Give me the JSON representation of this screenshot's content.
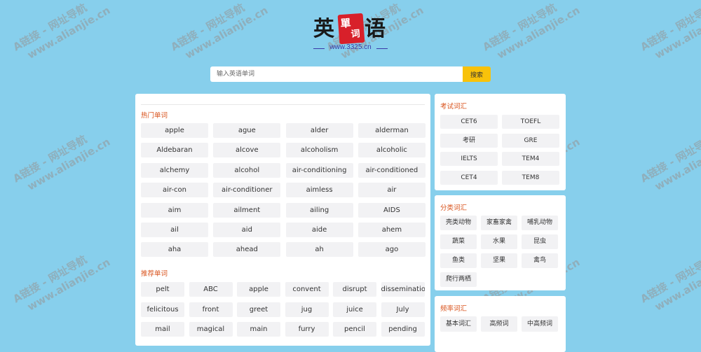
{
  "logo": {
    "char1": "英",
    "seal_char1": "單",
    "seal_char2": "词",
    "char2": "语",
    "url": "www.3325.cn"
  },
  "search": {
    "placeholder": "输入英语单词",
    "button_label": "搜索"
  },
  "hot": {
    "title": "热门单词",
    "items": [
      "apple",
      "ague",
      "alder",
      "alderman",
      "Aldebaran",
      "alcove",
      "alcoholism",
      "alcoholic",
      "alchemy",
      "alcohol",
      "air-conditioning",
      "air-conditioned",
      "air-con",
      "air-conditioner",
      "aimless",
      "air",
      "aim",
      "ailment",
      "ailing",
      "AIDS",
      "ail",
      "aid",
      "aide",
      "ahem",
      "aha",
      "ahead",
      "ah",
      "ago"
    ]
  },
  "recommended": {
    "title": "推荐单词",
    "items": [
      "pelt",
      "ABC",
      "apple",
      "convent",
      "disrupt",
      "dissemination",
      "felicitous",
      "front",
      "greet",
      "jug",
      "juice",
      "July",
      "mail",
      "magical",
      "main",
      "furry",
      "pencil",
      "pending"
    ]
  },
  "exam": {
    "title": "考试词汇",
    "items": [
      "CET6",
      "TOEFL",
      "考研",
      "GRE",
      "IELTS",
      "TEM4",
      "CET4",
      "TEM8"
    ]
  },
  "category": {
    "title": "分类词汇",
    "items": [
      "壳类动物",
      "家畜家禽",
      "哺乳动物",
      "蔬菜",
      "水果",
      "昆虫",
      "鱼类",
      "坚果",
      "禽鸟",
      "爬行两栖"
    ]
  },
  "frequency": {
    "title": "频率词汇",
    "items": [
      "基本词汇",
      "高频词",
      "中高频词"
    ]
  },
  "watermark": {
    "line1": "A链接 - 网址导航",
    "line2": "www.alianjie.cn"
  }
}
